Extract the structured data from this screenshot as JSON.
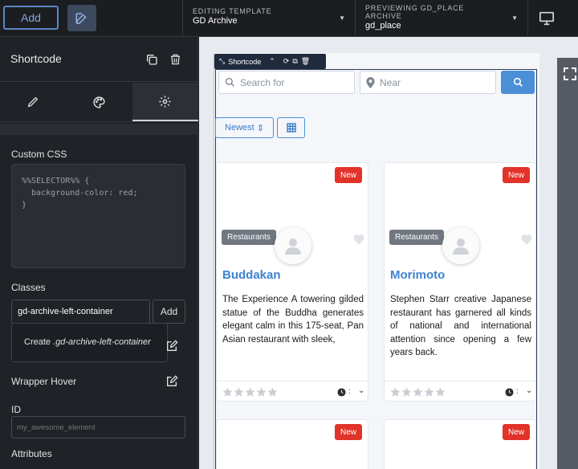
{
  "topbar": {
    "add_label": "Add",
    "editing": {
      "label": "EDITING TEMPLATE",
      "value": "GD Archive"
    },
    "previewing": {
      "label_line1": "PREVIEWING GD_PLACE",
      "label_line2": "ARCHIVE",
      "value": "gd_place"
    }
  },
  "panel": {
    "title": "Shortcode",
    "custom_css_label": "Custom CSS",
    "custom_css_code": "%%SELECTOR%% {\n  background-color: red;\n}",
    "classes_label": "Classes",
    "classes_value": "gd-archive-left-container",
    "classes_add": "Add",
    "suggest_prefix": "Create ",
    "suggest_value": ".gd-archive-left-container",
    "wrapper_hover_label": "Wrapper Hover",
    "id_label": "ID",
    "id_placeholder": "my_awesome_element",
    "attributes_label": "Attributes"
  },
  "canvas": {
    "shortcode_label": "Shortcode",
    "search_placeholder": "Search for",
    "near_placeholder": "Near",
    "sort_label": "Newest",
    "cards": [
      {
        "badge": "New",
        "category": "Restaurants",
        "title": "Buddakan",
        "description": "The Experience A towering gilded statue of the Buddha generates elegant calm in this 175-seat, Pan Asian restaurant with sleek,",
        "foot": ":"
      },
      {
        "badge": "New",
        "category": "Restaurants",
        "title": "Morimoto",
        "description": "Stephen Starr creative Japanese restaurant has garnered all kinds of national and international attention since opening a few years back.",
        "foot": ":"
      },
      {
        "badge": "New"
      },
      {
        "badge": "New"
      }
    ]
  },
  "colors": {
    "accent": "#4b8fd6",
    "new_badge": "#e2332a",
    "panel_bg": "#1f2226"
  }
}
